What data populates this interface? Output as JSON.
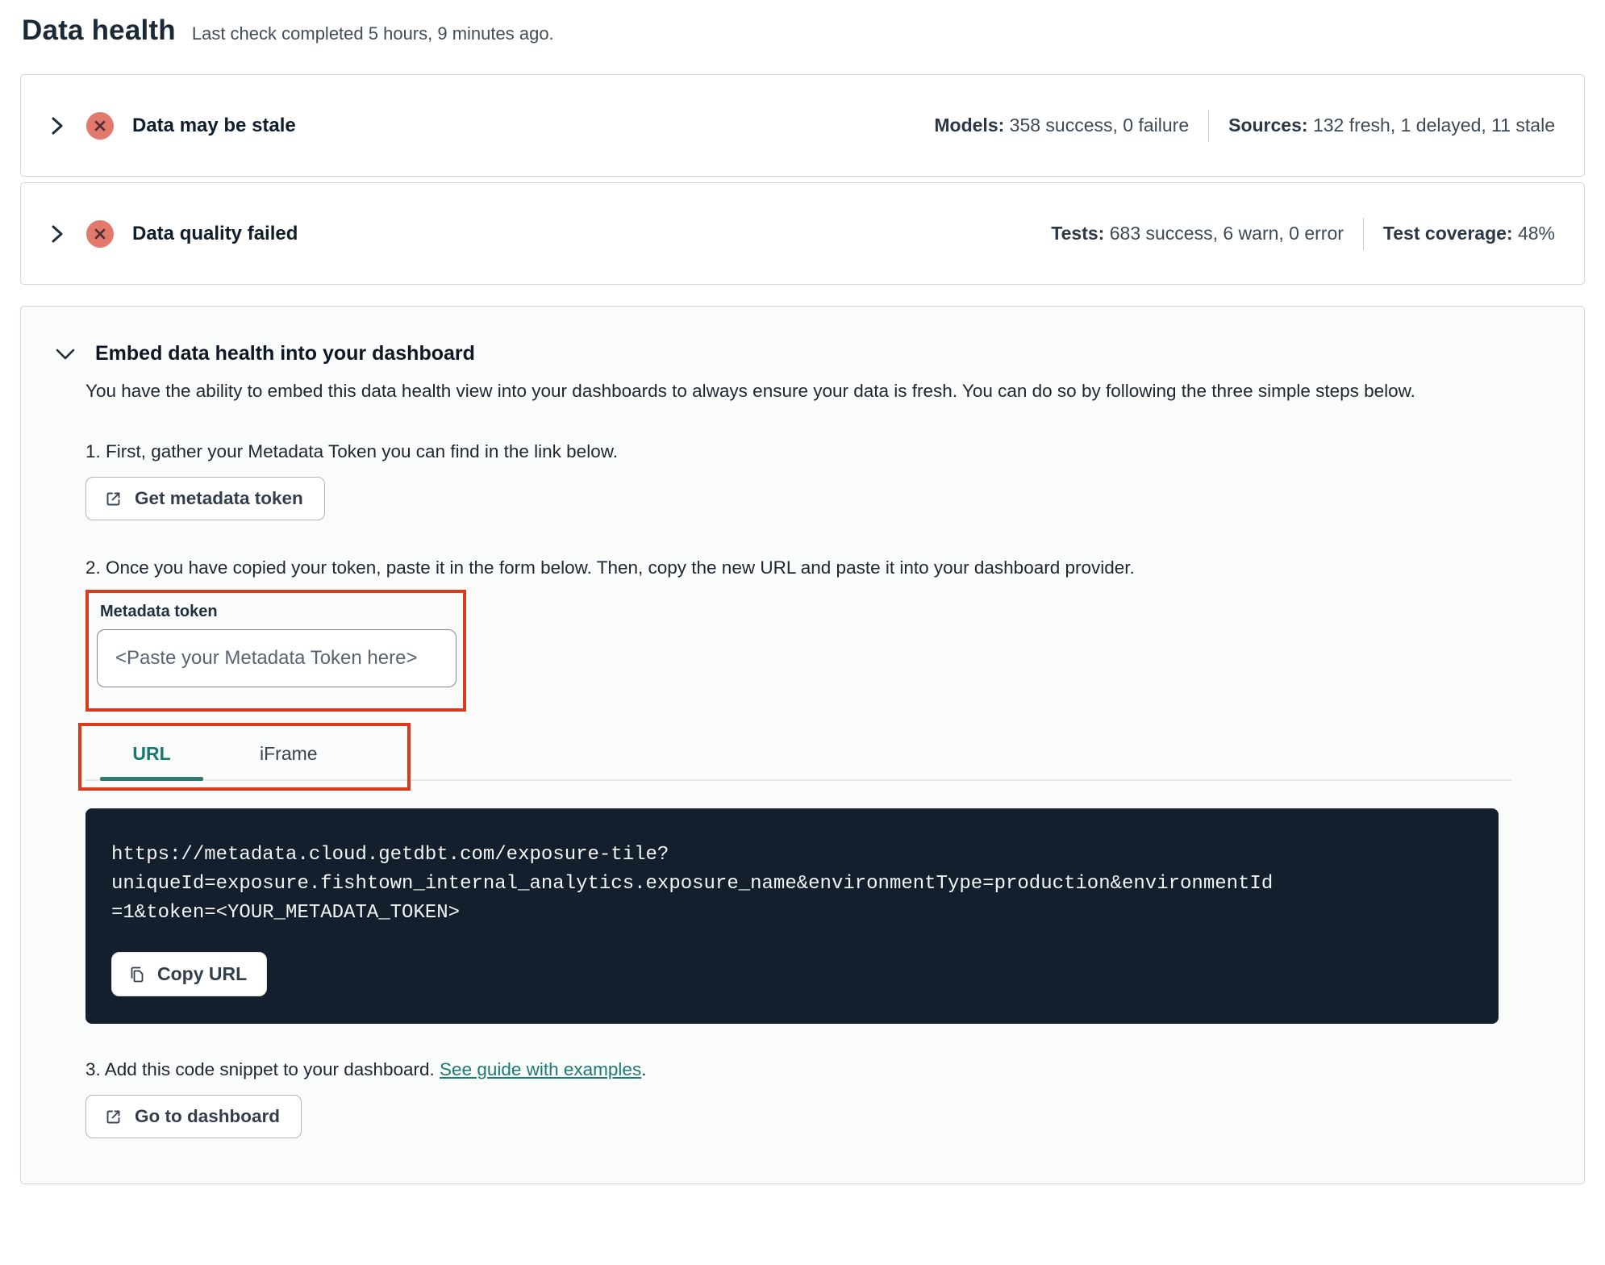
{
  "page": {
    "title": "Data health",
    "subtitle": "Last check completed 5 hours, 9 minutes ago."
  },
  "status_cards": [
    {
      "title": "Data may be stale",
      "status": "error",
      "metrics": [
        {
          "label": "Models:",
          "value": "358 success, 0 failure"
        },
        {
          "label": "Sources:",
          "value": "132 fresh, 1 delayed, 11 stale"
        }
      ]
    },
    {
      "title": "Data quality failed",
      "status": "error",
      "metrics": [
        {
          "label": "Tests:",
          "value": "683 success, 6 warn, 0 error"
        },
        {
          "label": "Test coverage:",
          "value": "48%"
        }
      ]
    }
  ],
  "embed_section": {
    "title": "Embed data health into your dashboard",
    "description": "You have the ability to embed this data health view into your dashboards to always ensure your data is fresh. You can do so by following the three simple steps below.",
    "step1": {
      "text": "1. First, gather your Metadata Token you can find in the link below.",
      "button_label": "Get metadata token"
    },
    "step2": {
      "text": "2. Once you have copied your token, paste it in the form below. Then, copy the new URL and paste it into your dashboard provider.",
      "token_field": {
        "label": "Metadata token",
        "value": "",
        "placeholder": "<Paste your Metadata Token here>"
      },
      "tabs": [
        {
          "label": "URL",
          "active": true
        },
        {
          "label": "iFrame",
          "active": false
        }
      ],
      "code_block": {
        "full_url": "https://metadata.cloud.getdbt.com/exposure-tile?uniqueId=exposure.fishtown_internal_analytics.exposure_name&environmentType=production&environmentId=1&token=<YOUR_METADATA_TOKEN>",
        "lines": [
          "https://metadata.cloud.getdbt.com/exposure-tile?",
          "uniqueId=exposure.fishtown_internal_analytics.exposure_name&environmentType=production&environmentId",
          "=1&token=<YOUR_METADATA_TOKEN>"
        ],
        "copy_button_label": "Copy URL"
      }
    },
    "step3": {
      "text_before_link": "3. Add this code snippet to your dashboard. ",
      "link_text": "See guide with examples",
      "text_after_link": ".",
      "button_label": "Go to dashboard"
    }
  },
  "icons": {
    "chevron-right-icon": "collapsed row expander",
    "chevron-down-icon": "expanded section",
    "x-circle-icon": "error status",
    "external-link-icon": "opens external page",
    "copy-icon": "copy to clipboard"
  },
  "colors": {
    "error_badge": "#e3786d",
    "error_badge_glyph": "#4b2e34",
    "accent_teal": "#17786e",
    "annotation_red": "#d93b1f",
    "code_background": "#141f2d",
    "card_border": "#d1d6db",
    "embed_background": "#fafbfb"
  }
}
